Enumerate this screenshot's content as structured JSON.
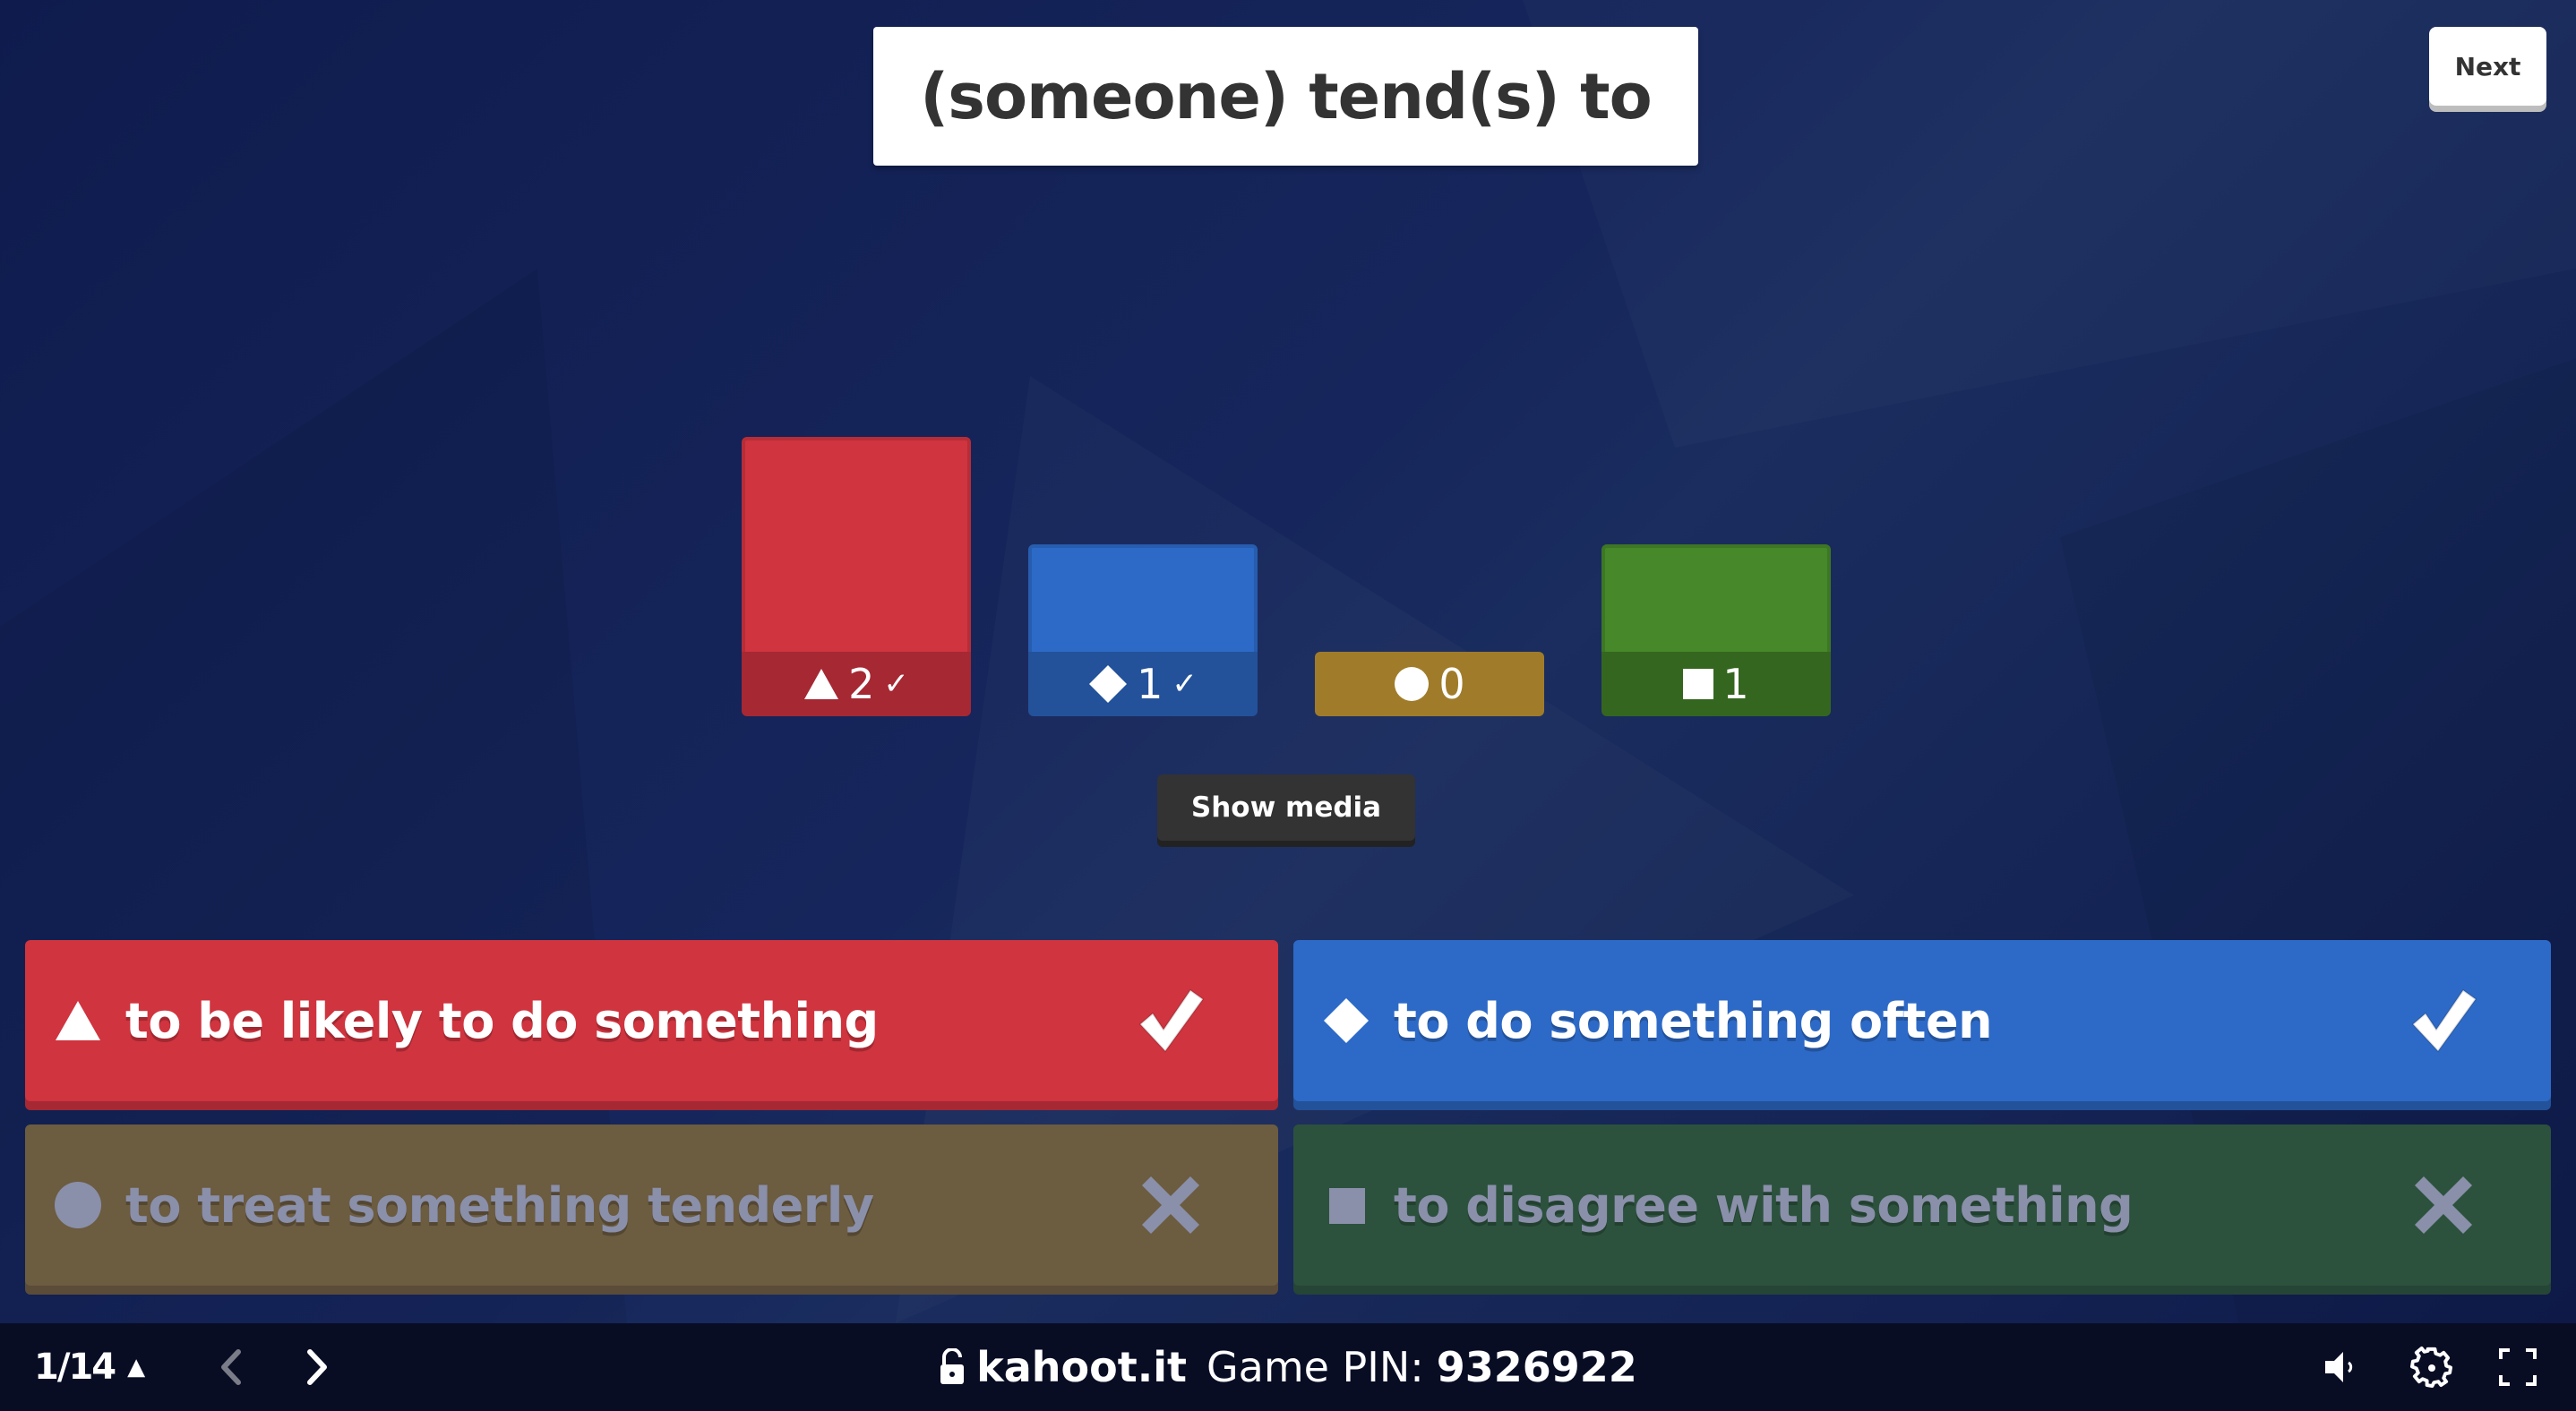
{
  "question": {
    "title": "(someone) tend(s) to"
  },
  "toolbar": {
    "next_label": "Next",
    "show_media_label": "Show media"
  },
  "colors": {
    "red": "#d0343f",
    "red_dark": "#a52833",
    "blue": "#2d6ac7",
    "blue_dark": "#23529a",
    "yellow": "#a07c2a",
    "yellow_dark": "#a07c2a",
    "green": "#46882a",
    "green_dark": "#35661f",
    "brown_faded": "#6c5c40",
    "green_faded": "#2c523d",
    "faded_text": "#8a8faa"
  },
  "chart_data": {
    "type": "bar",
    "title": "(someone) tend(s) to",
    "categories": [
      "triangle",
      "diamond",
      "circle",
      "square"
    ],
    "values": [
      2,
      1,
      0,
      1
    ],
    "correct": [
      true,
      true,
      false,
      false
    ],
    "xlabel": "",
    "ylabel": "",
    "ylim": [
      0,
      2
    ]
  },
  "answers": [
    {
      "shape": "triangle",
      "text": "to be likely to do something",
      "correct": true
    },
    {
      "shape": "diamond",
      "text": "to do something often",
      "correct": true
    },
    {
      "shape": "circle",
      "text": "to treat something tenderly",
      "correct": false
    },
    {
      "shape": "square",
      "text": "to disagree with something",
      "correct": false
    }
  ],
  "footer": {
    "page_counter": "1/14",
    "counter_toggle": "▲",
    "site": "kahoot.it",
    "pin_label": "Game PIN:",
    "pin": "9326922"
  }
}
